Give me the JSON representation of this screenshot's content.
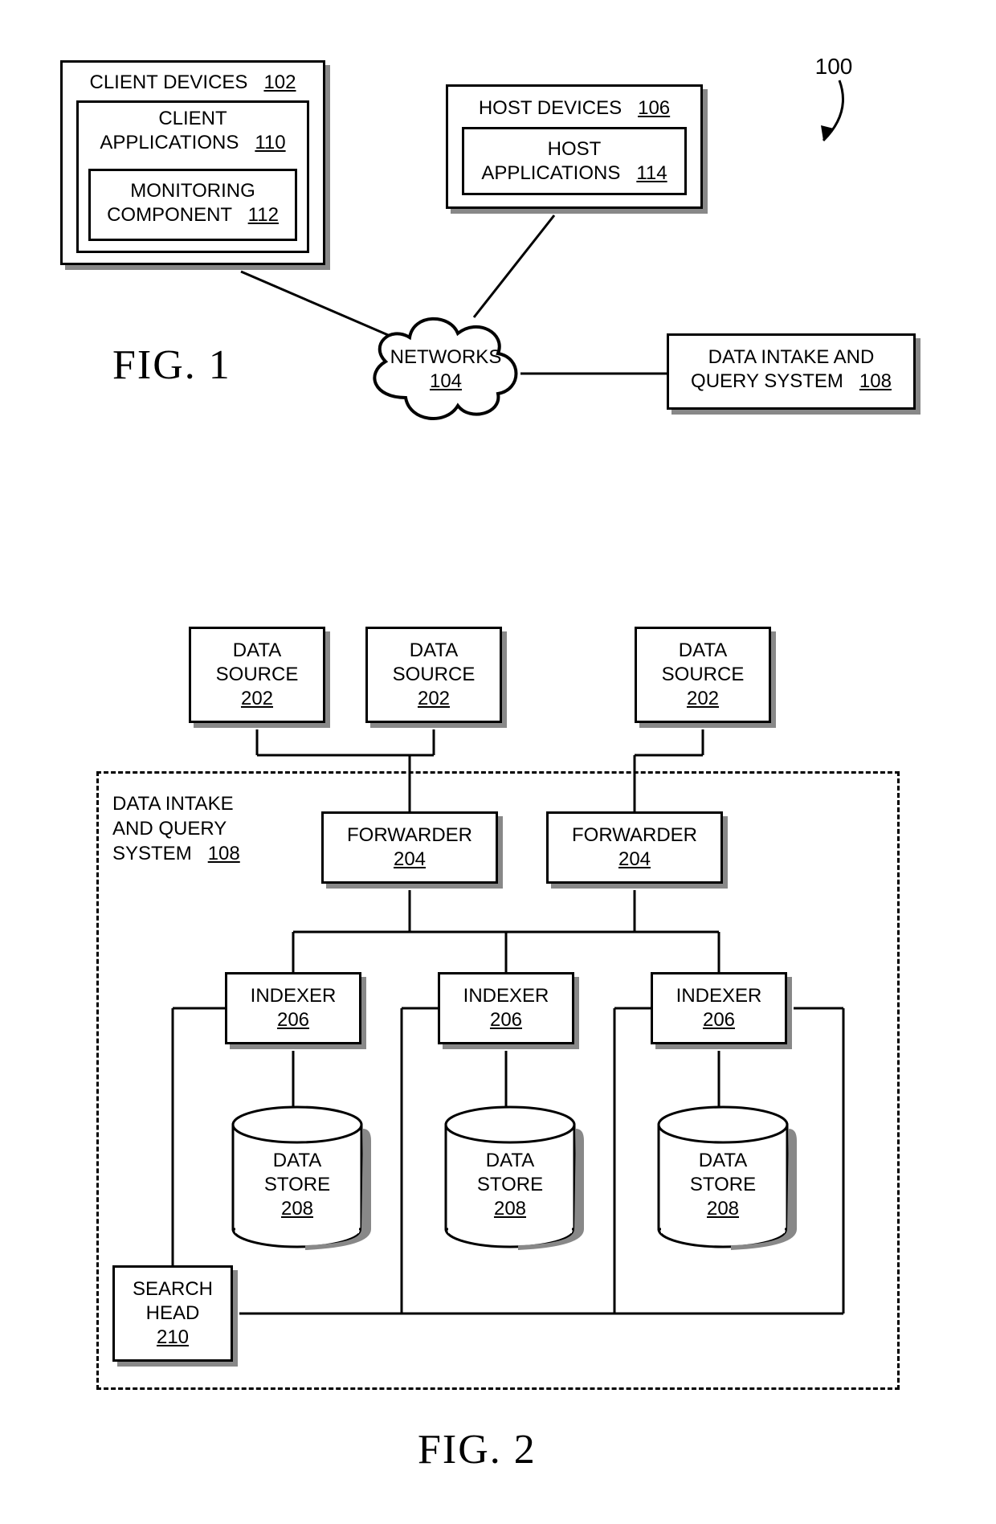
{
  "fig1": {
    "label": "FIG. 1",
    "overall_ref": "100",
    "client_devices": {
      "title": "CLIENT DEVICES",
      "ref": "102"
    },
    "client_applications": {
      "title": "CLIENT APPLICATIONS",
      "ref": "110"
    },
    "monitoring_component": {
      "title": "MONITORING COMPONENT",
      "ref": "112"
    },
    "host_devices": {
      "title": "HOST DEVICES",
      "ref": "106"
    },
    "host_applications": {
      "title": "HOST APPLICATIONS",
      "ref": "114"
    },
    "networks": {
      "title": "NETWORKS",
      "ref": "104"
    },
    "data_intake_query": {
      "title_line1": "DATA INTAKE AND",
      "title_line2": "QUERY SYSTEM",
      "ref": "108"
    }
  },
  "fig2": {
    "label": "FIG. 2",
    "system_box": {
      "title_line1": "DATA INTAKE",
      "title_line2": "AND QUERY",
      "title_line3": "SYSTEM",
      "ref": "108"
    },
    "data_source": {
      "title_line1": "DATA",
      "title_line2": "SOURCE",
      "ref": "202"
    },
    "forwarder": {
      "title": "FORWARDER",
      "ref": "204"
    },
    "indexer": {
      "title": "INDEXER",
      "ref": "206"
    },
    "data_store": {
      "title_line1": "DATA",
      "title_line2": "STORE",
      "ref": "208"
    },
    "search_head": {
      "title_line1": "SEARCH",
      "title_line2": "HEAD",
      "ref": "210"
    }
  }
}
